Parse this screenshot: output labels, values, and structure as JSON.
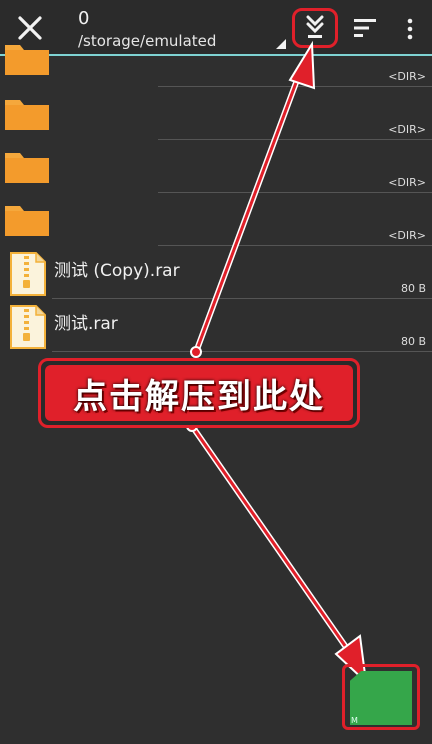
{
  "toolbar": {
    "count": "0",
    "path": "/storage/emulated"
  },
  "rows": [
    {
      "type": "folder",
      "meta": "<DIR>"
    },
    {
      "type": "folder",
      "meta": "<DIR>"
    },
    {
      "type": "folder",
      "meta": "<DIR>"
    },
    {
      "type": "folder",
      "meta": "<DIR>"
    },
    {
      "type": "file",
      "name": "测试 (Copy).rar",
      "meta": "80 B"
    },
    {
      "type": "file",
      "name": "测试.rar",
      "meta": "80 B"
    }
  ],
  "callout": {
    "text": "点击解压到此处"
  },
  "fab": {
    "label": "M"
  },
  "colors": {
    "accent": "#7fd3d3",
    "annotation": "#e0202a",
    "folder": "#f39b2c",
    "fab": "#35a64a"
  },
  "icons": [
    "close-icon",
    "extract-here-icon",
    "sort-icon",
    "more-vert-icon",
    "folder-icon",
    "archive-file-icon"
  ]
}
